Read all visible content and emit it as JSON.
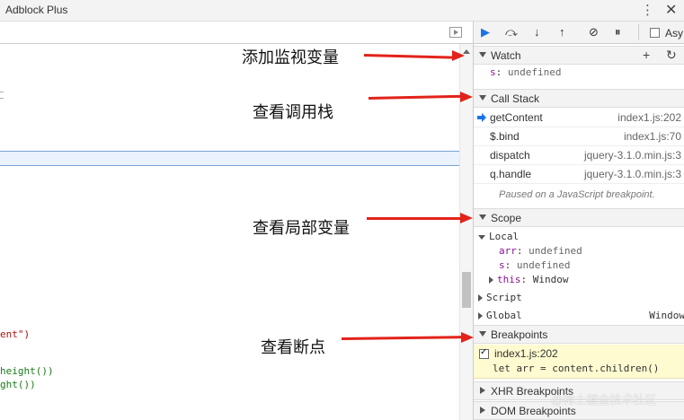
{
  "window": {
    "title": "Adblock Plus",
    "menu_icon": "kebab-icon",
    "close_icon": "close-icon"
  },
  "editor": {
    "code_lines": [
      "ent\")",
      "height())",
      "ght())"
    ]
  },
  "debugger_toolbar": {
    "buttons": [
      "resume-icon",
      "step-over-icon",
      "step-into-icon",
      "step-out-icon",
      "deactivate-breakpoints-icon",
      "pause-on-exceptions-icon"
    ],
    "async_label": "Asy"
  },
  "watch": {
    "title": "Watch",
    "expr_name": "s",
    "expr_value": "undefined"
  },
  "call_stack": {
    "title": "Call Stack",
    "frames": [
      {
        "fn": "getContent",
        "loc": "index1.js:202"
      },
      {
        "fn": "$.bind",
        "loc": "index1.js:70"
      },
      {
        "fn": "dispatch",
        "loc": "jquery-3.1.0.min.js:3"
      },
      {
        "fn": "q.handle",
        "loc": "jquery-3.1.0.min.js:3"
      }
    ],
    "paused_msg": "Paused on a JavaScript breakpoint."
  },
  "scope": {
    "title": "Scope",
    "local_label": "Local",
    "vars": [
      {
        "name": "arr",
        "value": "undefined"
      },
      {
        "name": "s",
        "value": "undefined"
      },
      {
        "name": "this",
        "value": "Window"
      }
    ],
    "script_label": "Script",
    "global_label": "Global",
    "global_value": "Window"
  },
  "breakpoints": {
    "title": "Breakpoints",
    "file": "index1.js:202",
    "code": "let arr = content.children()"
  },
  "xhr": {
    "title": "XHR Breakpoints"
  },
  "dom": {
    "title": "DOM Breakpoints"
  },
  "annotations": {
    "watch": "添加监视变量",
    "callstack": "查看调用栈",
    "scope": "查看局部变量",
    "breakpoints": "查看断点"
  },
  "watermark": "@稀土掘金技术社区",
  "colors": {
    "arrow": "#e2231a",
    "active_blue": "#1a73e8",
    "breakpoint_bg": "#fffbd0"
  }
}
